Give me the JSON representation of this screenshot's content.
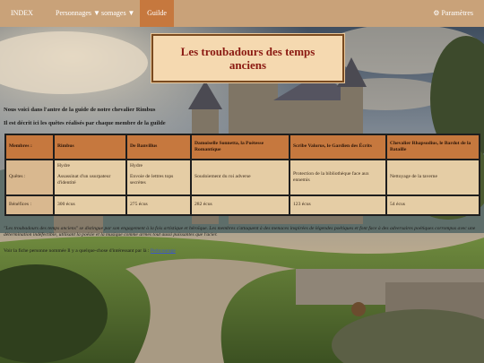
{
  "nav": {
    "index": "INDEX",
    "persos": "Personnages ▼",
    "somm": "somages ▼",
    "guilde": "Guilde",
    "params": "Paramètres"
  },
  "title": "Les troubadours des temps anciens",
  "intro": {
    "line1": "Nous voici dans l'antre de la guide de notre chevalier Rimbus",
    "line2": "Il est décrit ici les quêtes réalisés par chaque membre de la guilde"
  },
  "table": {
    "header": [
      "Membres :",
      "Rimbus",
      "De Banvillus",
      "Damoiselle Sonnetta, la Poétesse Romantique",
      "Scribe Valorus, le Gardien des Écrits",
      "Chevalier Rhapsodius, le Bardot de la Bataille"
    ],
    "quetes_label": "Quêtes :",
    "quetes": [
      [
        "Hydre",
        "Assassinat d'un usurpateur d'identité"
      ],
      [
        "Hydre",
        "Envoie de lettres tops secrètes"
      ],
      [
        "Soudoiement du roi adverse"
      ],
      [
        "Protection de la bibliothèque face aux ennemis"
      ],
      [
        "Nettoyage de la taverne"
      ]
    ],
    "benefices_label": "Bénéfices :",
    "benefices": [
      "300 écus",
      "275 écus",
      "282 écus",
      "123 écus",
      "54 écus"
    ]
  },
  "footer": {
    "para1": "\"Les troubadours des temps anciens\" se distingue par son engagement à la fois artistique et héroïque. Les membres s'attaquent à des menaces inspirées de légendes poétiques et font face à des adversaires poétiques corrompus avec une détermination indéfectible, utilisant la poésie et la musique comme armes tout aussi puissantes que l'acier.",
    "para2_prefix": "Voir la fiche personne nommée Il y a quelque-chose d'intéressant par là : ",
    "para2_link": "Petitcourage"
  },
  "colors": {
    "navbar": "#c9a279",
    "nav_active": "#c6783e",
    "title_bg": "#f5d9b0",
    "title_text": "#8b1a12",
    "table_header": "#c6783e",
    "table_cell": "#e5cda5",
    "link": "#3b56c9"
  },
  "icons": {
    "params": "gear-icon",
    "dropdown": "chevron-down-icon"
  }
}
